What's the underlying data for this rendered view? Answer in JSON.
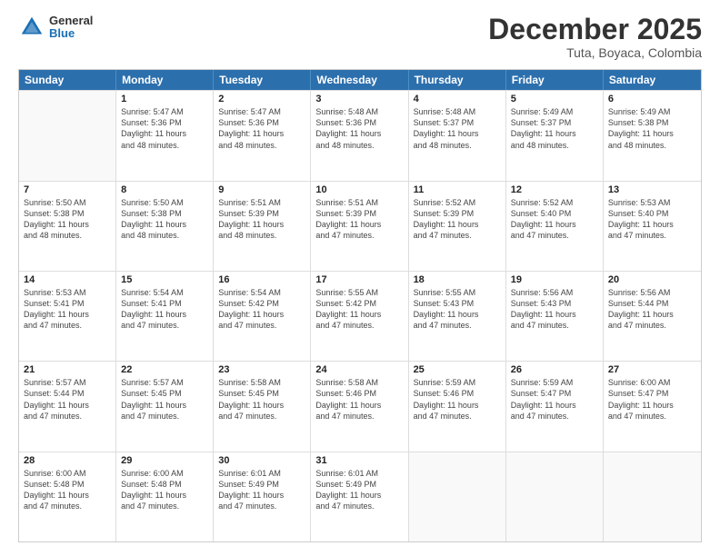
{
  "header": {
    "logo_general": "General",
    "logo_blue": "Blue",
    "month_title": "December 2025",
    "location": "Tuta, Boyaca, Colombia"
  },
  "weekdays": [
    "Sunday",
    "Monday",
    "Tuesday",
    "Wednesday",
    "Thursday",
    "Friday",
    "Saturday"
  ],
  "rows": [
    [
      {
        "day": "",
        "info": ""
      },
      {
        "day": "1",
        "info": "Sunrise: 5:47 AM\nSunset: 5:36 PM\nDaylight: 11 hours\nand 48 minutes."
      },
      {
        "day": "2",
        "info": "Sunrise: 5:47 AM\nSunset: 5:36 PM\nDaylight: 11 hours\nand 48 minutes."
      },
      {
        "day": "3",
        "info": "Sunrise: 5:48 AM\nSunset: 5:36 PM\nDaylight: 11 hours\nand 48 minutes."
      },
      {
        "day": "4",
        "info": "Sunrise: 5:48 AM\nSunset: 5:37 PM\nDaylight: 11 hours\nand 48 minutes."
      },
      {
        "day": "5",
        "info": "Sunrise: 5:49 AM\nSunset: 5:37 PM\nDaylight: 11 hours\nand 48 minutes."
      },
      {
        "day": "6",
        "info": "Sunrise: 5:49 AM\nSunset: 5:38 PM\nDaylight: 11 hours\nand 48 minutes."
      }
    ],
    [
      {
        "day": "7",
        "info": "Sunrise: 5:50 AM\nSunset: 5:38 PM\nDaylight: 11 hours\nand 48 minutes."
      },
      {
        "day": "8",
        "info": "Sunrise: 5:50 AM\nSunset: 5:38 PM\nDaylight: 11 hours\nand 48 minutes."
      },
      {
        "day": "9",
        "info": "Sunrise: 5:51 AM\nSunset: 5:39 PM\nDaylight: 11 hours\nand 48 minutes."
      },
      {
        "day": "10",
        "info": "Sunrise: 5:51 AM\nSunset: 5:39 PM\nDaylight: 11 hours\nand 47 minutes."
      },
      {
        "day": "11",
        "info": "Sunrise: 5:52 AM\nSunset: 5:39 PM\nDaylight: 11 hours\nand 47 minutes."
      },
      {
        "day": "12",
        "info": "Sunrise: 5:52 AM\nSunset: 5:40 PM\nDaylight: 11 hours\nand 47 minutes."
      },
      {
        "day": "13",
        "info": "Sunrise: 5:53 AM\nSunset: 5:40 PM\nDaylight: 11 hours\nand 47 minutes."
      }
    ],
    [
      {
        "day": "14",
        "info": "Sunrise: 5:53 AM\nSunset: 5:41 PM\nDaylight: 11 hours\nand 47 minutes."
      },
      {
        "day": "15",
        "info": "Sunrise: 5:54 AM\nSunset: 5:41 PM\nDaylight: 11 hours\nand 47 minutes."
      },
      {
        "day": "16",
        "info": "Sunrise: 5:54 AM\nSunset: 5:42 PM\nDaylight: 11 hours\nand 47 minutes."
      },
      {
        "day": "17",
        "info": "Sunrise: 5:55 AM\nSunset: 5:42 PM\nDaylight: 11 hours\nand 47 minutes."
      },
      {
        "day": "18",
        "info": "Sunrise: 5:55 AM\nSunset: 5:43 PM\nDaylight: 11 hours\nand 47 minutes."
      },
      {
        "day": "19",
        "info": "Sunrise: 5:56 AM\nSunset: 5:43 PM\nDaylight: 11 hours\nand 47 minutes."
      },
      {
        "day": "20",
        "info": "Sunrise: 5:56 AM\nSunset: 5:44 PM\nDaylight: 11 hours\nand 47 minutes."
      }
    ],
    [
      {
        "day": "21",
        "info": "Sunrise: 5:57 AM\nSunset: 5:44 PM\nDaylight: 11 hours\nand 47 minutes."
      },
      {
        "day": "22",
        "info": "Sunrise: 5:57 AM\nSunset: 5:45 PM\nDaylight: 11 hours\nand 47 minutes."
      },
      {
        "day": "23",
        "info": "Sunrise: 5:58 AM\nSunset: 5:45 PM\nDaylight: 11 hours\nand 47 minutes."
      },
      {
        "day": "24",
        "info": "Sunrise: 5:58 AM\nSunset: 5:46 PM\nDaylight: 11 hours\nand 47 minutes."
      },
      {
        "day": "25",
        "info": "Sunrise: 5:59 AM\nSunset: 5:46 PM\nDaylight: 11 hours\nand 47 minutes."
      },
      {
        "day": "26",
        "info": "Sunrise: 5:59 AM\nSunset: 5:47 PM\nDaylight: 11 hours\nand 47 minutes."
      },
      {
        "day": "27",
        "info": "Sunrise: 6:00 AM\nSunset: 5:47 PM\nDaylight: 11 hours\nand 47 minutes."
      }
    ],
    [
      {
        "day": "28",
        "info": "Sunrise: 6:00 AM\nSunset: 5:48 PM\nDaylight: 11 hours\nand 47 minutes."
      },
      {
        "day": "29",
        "info": "Sunrise: 6:00 AM\nSunset: 5:48 PM\nDaylight: 11 hours\nand 47 minutes."
      },
      {
        "day": "30",
        "info": "Sunrise: 6:01 AM\nSunset: 5:49 PM\nDaylight: 11 hours\nand 47 minutes."
      },
      {
        "day": "31",
        "info": "Sunrise: 6:01 AM\nSunset: 5:49 PM\nDaylight: 11 hours\nand 47 minutes."
      },
      {
        "day": "",
        "info": ""
      },
      {
        "day": "",
        "info": ""
      },
      {
        "day": "",
        "info": ""
      }
    ]
  ]
}
